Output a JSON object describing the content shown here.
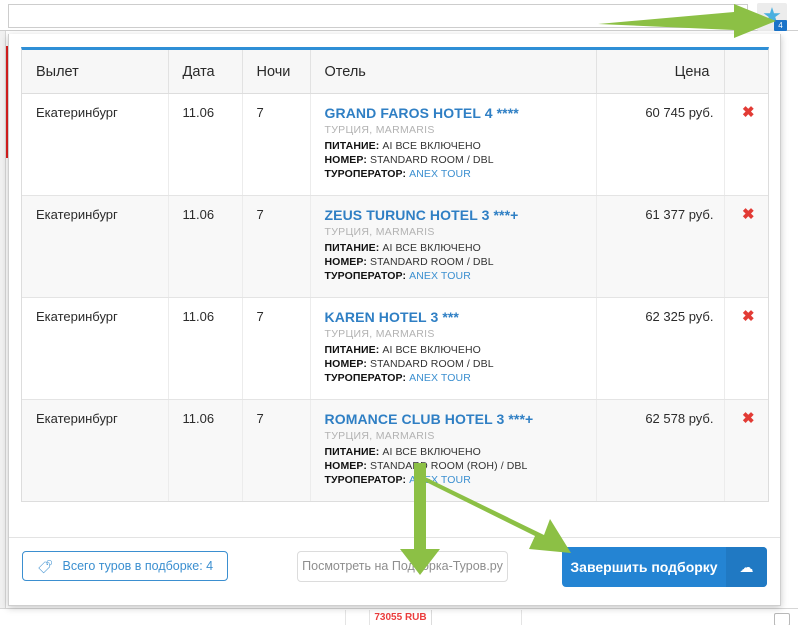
{
  "browser": {
    "star_icon": "star-icon",
    "star_badge_count": "4"
  },
  "table": {
    "columns": [
      {
        "key": "departure",
        "label": "Вылет"
      },
      {
        "key": "date",
        "label": "Дата"
      },
      {
        "key": "nights",
        "label": "Ночи"
      },
      {
        "key": "hotel",
        "label": "Отель"
      },
      {
        "key": "price",
        "label": "Цена"
      },
      {
        "key": "remove",
        "label": ""
      }
    ],
    "labels": {
      "meal": "ПИТАНИЕ:",
      "room": "НОМЕР:",
      "operator": "ТУРОПЕРАТОР:"
    },
    "remove_icon": "✖",
    "rows": [
      {
        "departure": "Екатеринбург",
        "date": "11.06",
        "nights": "7",
        "hotel_name": "GRAND FAROS HOTEL 4 ****",
        "geo": "ТУРЦИЯ, MARMARIS",
        "meal": "AI ВСЕ ВКЛЮЧЕНО",
        "room": "STANDARD ROOM / DBL",
        "operator": "ANEX TOUR",
        "price": "60 745 руб."
      },
      {
        "departure": "Екатеринбург",
        "date": "11.06",
        "nights": "7",
        "hotel_name": "ZEUS TURUNC HOTEL 3 ***+",
        "geo": "ТУРЦИЯ, MARMARIS",
        "meal": "AI ВСЕ ВКЛЮЧЕНО",
        "room": "STANDARD ROOM / DBL",
        "operator": "ANEX TOUR",
        "price": "61 377 руб."
      },
      {
        "departure": "Екатеринбург",
        "date": "11.06",
        "nights": "7",
        "hotel_name": "KAREN HOTEL 3 ***",
        "geo": "ТУРЦИЯ, MARMARIS",
        "meal": "AI ВСЕ ВКЛЮЧЕНО",
        "room": "STANDARD ROOM / DBL",
        "operator": "ANEX TOUR",
        "price": "62 325 руб."
      },
      {
        "departure": "Екатеринбург",
        "date": "11.06",
        "nights": "7",
        "hotel_name": "ROMANCE CLUB HOTEL 3 ***+",
        "geo": "ТУРЦИЯ, MARMARIS",
        "meal": "AI ВСЕ ВКЛЮЧЕНО",
        "room": "STANDARD ROOM (ROH) / DBL",
        "operator": "ANEX TOUR",
        "price": "62 578 руб."
      }
    ]
  },
  "footer": {
    "count_label": "Всего туров в подборке: 4",
    "count_icon": "tag-icon",
    "view_label": "Посмотреть на Подборка-Туров.ру",
    "finish_label": "Завершить подборку",
    "finish_icon": "cloud-icon"
  },
  "background": {
    "price_cell": "73055 RUB"
  },
  "colors": {
    "accent_blue": "#2484d3",
    "link_blue": "#2f7fc4",
    "header_bar": "#2f8fd6",
    "arrow_green": "#8cc045",
    "remove_red": "#e23b35",
    "star_blue": "#4ab0e0",
    "badge_blue": "#1a73c8"
  }
}
